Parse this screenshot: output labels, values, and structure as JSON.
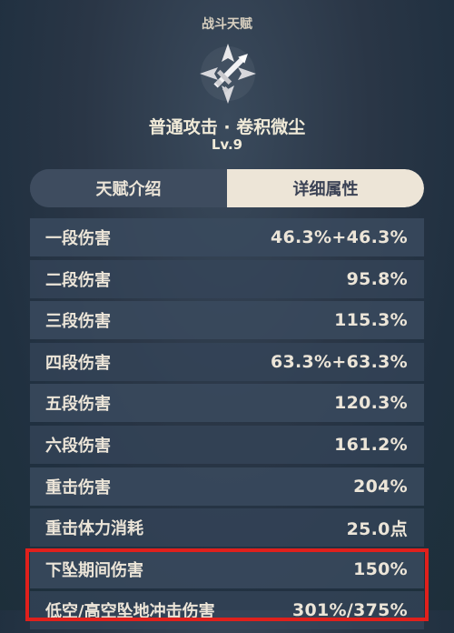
{
  "header": {
    "category": "战斗天赋"
  },
  "talent": {
    "name": "普通攻击 · 卷积微尘",
    "level": "Lv.9",
    "icon": "sword-emblem-icon"
  },
  "tabs": [
    {
      "label": "天赋介绍",
      "active": false
    },
    {
      "label": "详细属性",
      "active": true
    }
  ],
  "attributes": [
    {
      "label": "一段伤害",
      "value": "46.3%+46.3%"
    },
    {
      "label": "二段伤害",
      "value": "95.8%"
    },
    {
      "label": "三段伤害",
      "value": "115.3%"
    },
    {
      "label": "四段伤害",
      "value": "63.3%+63.3%"
    },
    {
      "label": "五段伤害",
      "value": "120.3%"
    },
    {
      "label": "六段伤害",
      "value": "161.2%"
    },
    {
      "label": "重击伤害",
      "value": "204%"
    },
    {
      "label": "重击体力消耗",
      "value": "25.0点"
    },
    {
      "label": "下坠期间伤害",
      "value": "150%"
    },
    {
      "label": "低空/高空坠地冲击伤害",
      "value": "301%/375%"
    }
  ],
  "colors": {
    "highlight": "#e0201c",
    "active_tab": "#ede5d7",
    "text": "#ece5d8"
  }
}
